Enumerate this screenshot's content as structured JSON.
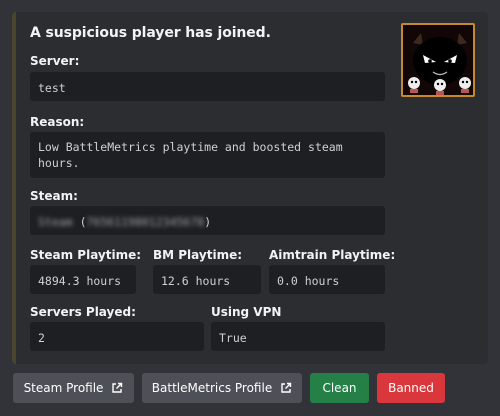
{
  "embed": {
    "title": "A suspicious player has joined.",
    "accent_color": "#49452e",
    "server": {
      "label": "Server:",
      "value": "test"
    },
    "reason": {
      "label": "Reason:",
      "value": "Low BattleMetrics playtime and boosted steam hours."
    },
    "steam": {
      "label": "Steam:",
      "name": "Steam",
      "id": "76561198012345678"
    },
    "steam_playtime": {
      "label": "Steam Playtime:",
      "value": "4894.3 hours"
    },
    "bm_playtime": {
      "label": "BM Playtime:",
      "value": "12.6 hours"
    },
    "aimtrain_playtime": {
      "label": "Aimtrain Playtime:",
      "value": "0.0 hours"
    },
    "servers_played": {
      "label": "Servers Played:",
      "value": "2"
    },
    "using_vpn": {
      "label": "Using VPN",
      "value": "True"
    },
    "thumbnail": "black-cat-avatar"
  },
  "buttons": {
    "steam_profile": "Steam Profile",
    "battlemetrics_profile": "BattleMetrics Profile",
    "clean": "Clean",
    "banned": "Banned"
  },
  "colors": {
    "clean": "#248046",
    "banned": "#da373c",
    "link": "#4e5058"
  },
  "icons": {
    "link": "external-link-icon"
  }
}
